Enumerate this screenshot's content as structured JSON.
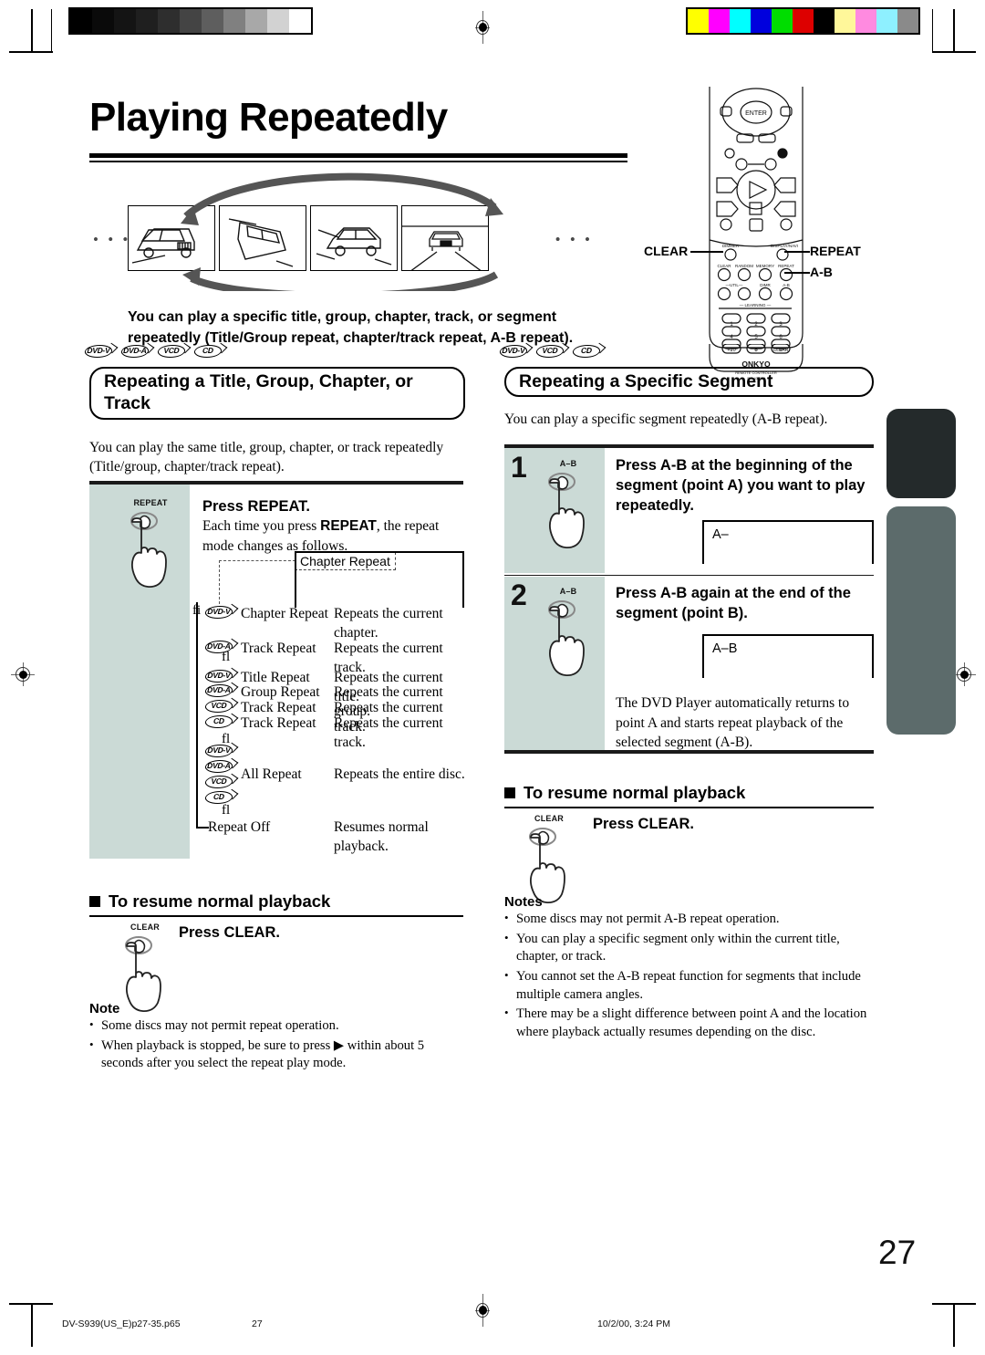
{
  "page": {
    "title": "Playing Repeatedly",
    "number": "27"
  },
  "intro": {
    "line1": "You can play a specific title, group, chapter, track, or segment",
    "line2": "repeatedly (Title/Group repeat, chapter/track repeat, A-B repeat)."
  },
  "hero": {
    "leading_ellipsis": "• • •",
    "trailing_ellipsis": "• • •",
    "frames": [
      "car-rear-quarter",
      "car-side-rear",
      "car-front-quarter",
      "car-front-road"
    ]
  },
  "remote": {
    "brand": "ONKYO",
    "sub1": "REMOTE CONTROLLER",
    "sub2": "RC-435DV",
    "enter_label": "ENTER",
    "callouts": {
      "left": "CLEAR",
      "right_top": "REPEAT",
      "right_bottom": "A-B"
    }
  },
  "left_section": {
    "discs": [
      "DVD-V",
      "DVD-A",
      "VCD",
      "CD"
    ],
    "heading_line1": "Repeating a Title, Group, Chapter, or",
    "heading_line2": "Track",
    "intro_line1": "You can play the same title, group, chapter, or track repeatedly",
    "intro_line2": "(Title/group, chapter/track repeat).",
    "step": {
      "button_label": "REPEAT",
      "title": "Press REPEAT.",
      "body_line1_a": "Each time you press ",
      "body_line1_b": "REPEAT",
      "body_line1_c": ", the repeat",
      "body_line2": "mode changes as follows."
    },
    "flow": {
      "callout": "Chapter Repeat",
      "arrow_up": "fi",
      "arrow_down": "fl",
      "rows": [
        {
          "discs": [
            "DVD-V"
          ],
          "label": "Chapter Repeat",
          "desc_line1": "Repeats the current",
          "desc_line2": "chapter."
        },
        {
          "discs": [
            "DVD-A"
          ],
          "label": "Track Repeat",
          "desc_line1": "Repeats the current track.",
          "desc_line2": ""
        },
        {
          "discs": [
            "DVD-V"
          ],
          "label": "Title Repeat",
          "desc_line1": "Repeats the current title.",
          "desc_line2": ""
        },
        {
          "discs": [
            "DVD-A"
          ],
          "label": "Group Repeat",
          "desc_line1": "Repeats the current group.",
          "desc_line2": ""
        },
        {
          "discs": [
            "VCD"
          ],
          "label": "Track Repeat",
          "desc_line1": "Repeats the current track.",
          "desc_line2": ""
        },
        {
          "discs": [
            "CD"
          ],
          "label": "Track Repeat",
          "desc_line1": "Repeats the current track.",
          "desc_line2": ""
        },
        {
          "discs": [
            "DVD-V",
            "DVD-A",
            "VCD",
            "CD"
          ],
          "label": "All Repeat",
          "desc_line1": "Repeats the entire disc.",
          "desc_line2": ""
        },
        {
          "discs": [],
          "label": "Repeat Off",
          "desc_line1": "Resumes normal",
          "desc_line2": "playback."
        }
      ]
    },
    "resume": {
      "heading": "To resume normal playback",
      "button_label": "CLEAR",
      "instruction": "Press CLEAR."
    },
    "notes": {
      "heading": "Note",
      "items": [
        "Some discs may not permit repeat operation.",
        "When playback is stopped, be sure to press ▶ within about 5 seconds after you select the repeat play mode."
      ],
      "item2_part1": "When playback is stopped, be sure to press",
      "item2_glyph": "▶",
      "item2_part2": "within about 5 seconds",
      "item2_part3": "after you select the repeat play mode."
    }
  },
  "right_section": {
    "discs": [
      "DVD-V",
      "VCD",
      "CD"
    ],
    "heading": "Repeating a Specific Segment",
    "intro": "You can play a specific segment repeatedly (A-B repeat).",
    "steps": [
      {
        "number": "1",
        "button_label": "A–B",
        "text_line1": "Press A-B at the beginning of the",
        "text_line2": "segment (point A) you want to play",
        "text_line3": "repeatedly.",
        "display": "A–"
      },
      {
        "number": "2",
        "button_label": "A–B",
        "text_line1": "Press A-B again at the end of the",
        "text_line2": "segment (point B).",
        "display": "A–B",
        "after_line1": "The DVD Player automatically returns to",
        "after_line2": "point A and starts repeat playback of the",
        "after_line3": "selected segment (A-B)."
      }
    ],
    "resume": {
      "heading": "To resume normal playback",
      "button_label": "CLEAR",
      "instruction": "Press CLEAR."
    },
    "notes": {
      "heading": "Notes",
      "items": [
        "Some discs may not permit A-B repeat operation.",
        "You can play a specific segment only within the current title, chapter, or track.",
        "You cannot set the A-B repeat function for segments that include multiple camera angles.",
        "There may be a slight difference between point A and the location where playback actually resumes depending on the disc."
      ]
    }
  },
  "footer": {
    "filename": "DV-S939(US_E)p27-35.p65",
    "page": "27",
    "timestamp": "10/2/00, 3:24 PM"
  },
  "calibration": {
    "grayscale": [
      "#000000",
      "#0a0a0a",
      "#141414",
      "#1f1f1f",
      "#2e2e2e",
      "#444444",
      "#5e5e5e",
      "#808080",
      "#a8a8a8",
      "#d2d2d2",
      "#ffffff"
    ],
    "colorbar": [
      "#ffff00",
      "#ff00ff",
      "#00ffff",
      "#0000dd",
      "#00dd00",
      "#dd0000",
      "#000000",
      "#fff79a",
      "#ff8ae0",
      "#8ef0ff",
      "#8a8a8a"
    ]
  },
  "sidetabs": {
    "top_color": "#242a2b",
    "bottom_color": "#5c6b6b"
  }
}
